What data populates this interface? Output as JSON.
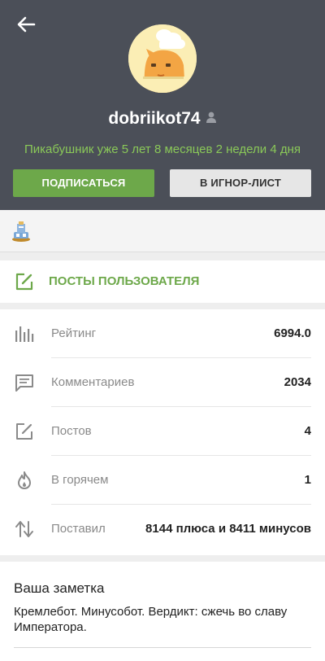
{
  "profile": {
    "username": "dobriikot74",
    "tenure": "Пикабушник уже 5 лет 8 месяцев 2 недели 4 дня",
    "subscribe_label": "ПОДПИСАТЬСЯ",
    "ignore_label": "В ИГНОР-ЛИСТ"
  },
  "posts": {
    "label": "ПОСТЫ ПОЛЬЗОВАТЕЛЯ"
  },
  "stats": [
    {
      "label": "Рейтинг",
      "value": "6994.0",
      "icon": "bar-chart-icon"
    },
    {
      "label": "Комментариев",
      "value": "2034",
      "icon": "comment-icon"
    },
    {
      "label": "Постов",
      "value": "4",
      "icon": "edit-icon"
    },
    {
      "label": "В горячем",
      "value": "1",
      "icon": "flame-icon"
    },
    {
      "label": "Поставил",
      "value": "8144 плюса и 8411 минусов",
      "icon": "up-down-arrows-icon"
    }
  ],
  "note": {
    "title": "Ваша заметка",
    "text": "Кремлебот. Минусобот. Вердикт: сжечь во славу Императора."
  },
  "colors": {
    "header": "#4b4f58",
    "accent_green": "#6da84a",
    "tenure_green": "#8ac858"
  }
}
